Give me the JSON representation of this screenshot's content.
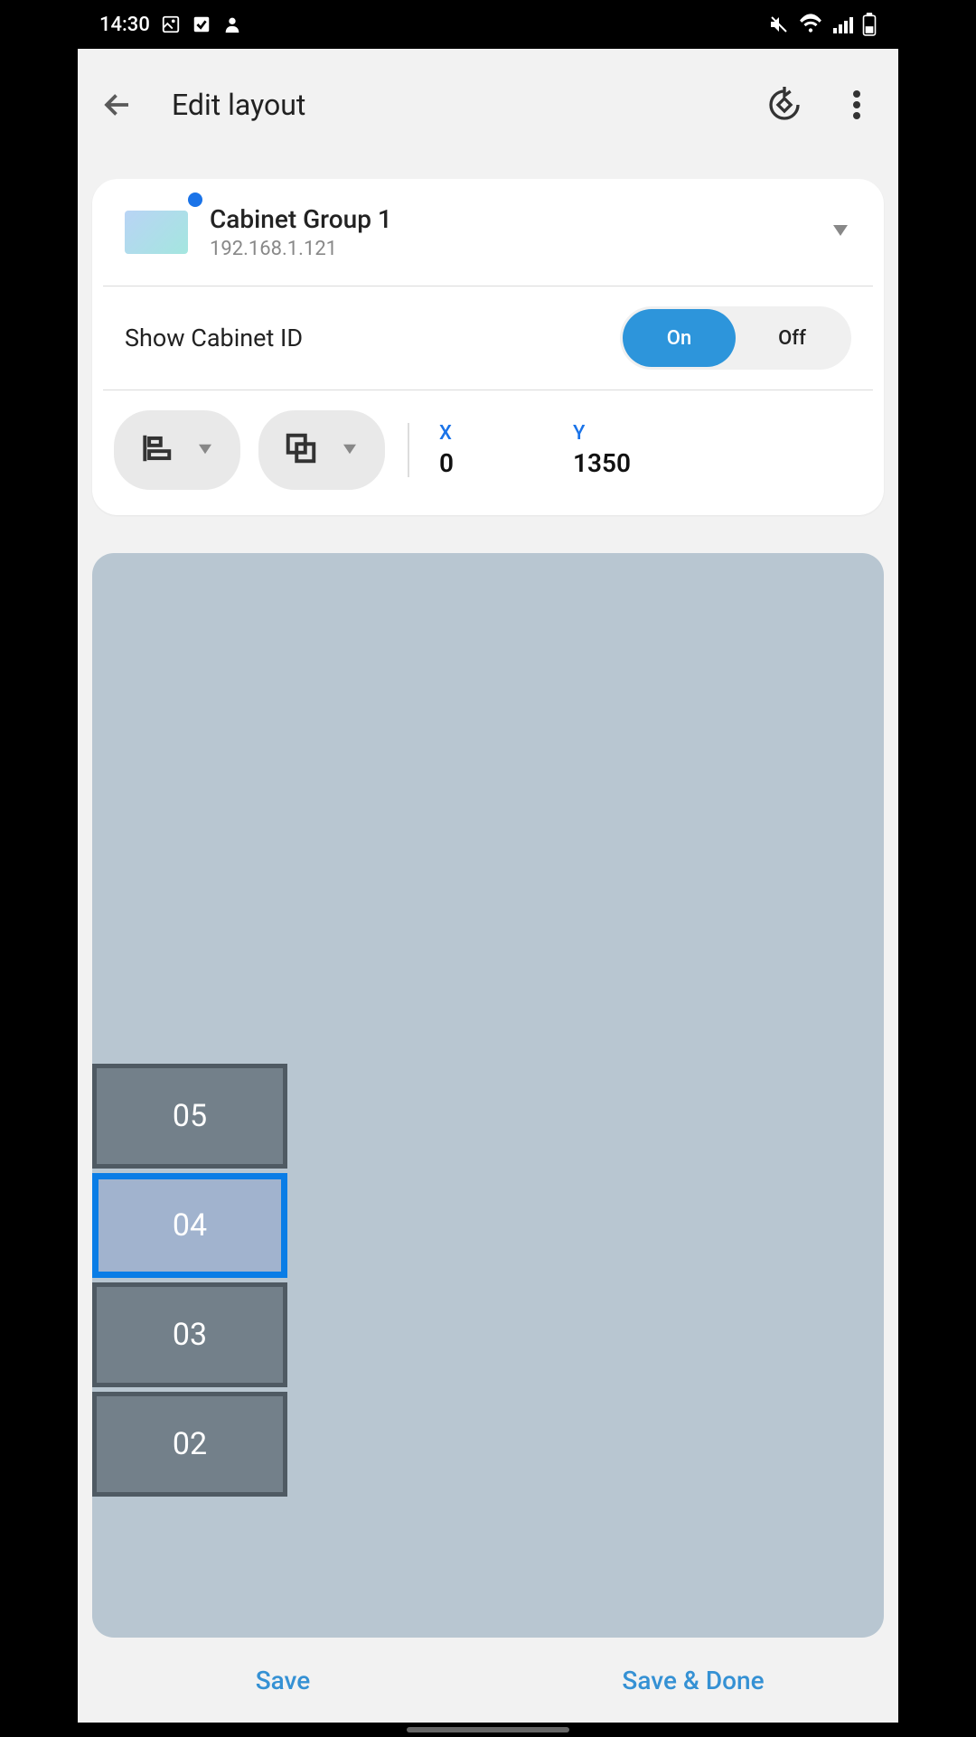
{
  "status": {
    "time": "14:30"
  },
  "appbar": {
    "title": "Edit layout"
  },
  "group": {
    "name": "Cabinet Group 1",
    "ip": "192.168.1.121"
  },
  "show_id": {
    "label": "Show Cabinet ID",
    "on": "On",
    "off": "Off",
    "value": "On"
  },
  "coords": {
    "x_label": "X",
    "x_value": "0",
    "y_label": "Y",
    "y_value": "1350"
  },
  "cabinets": [
    {
      "id": "05",
      "selected": false
    },
    {
      "id": "04",
      "selected": true
    },
    {
      "id": "03",
      "selected": false
    },
    {
      "id": "02",
      "selected": false
    }
  ],
  "bottom": {
    "save": "Save",
    "save_done": "Save & Done"
  }
}
